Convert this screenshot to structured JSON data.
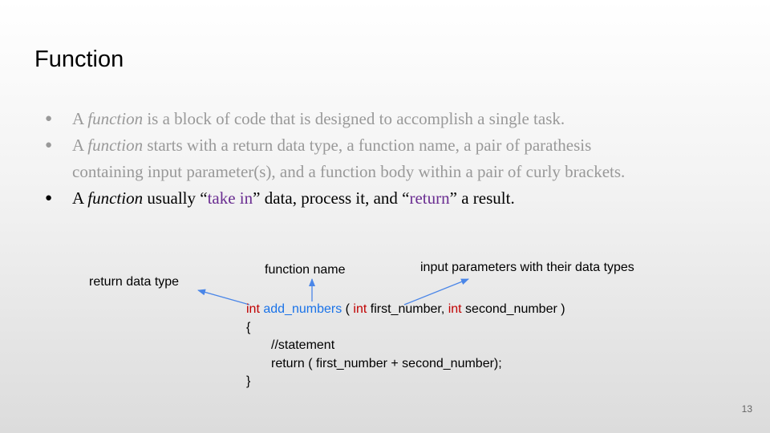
{
  "slide": {
    "title": "Function",
    "page_number": "13"
  },
  "bullets": [
    {
      "parts": [
        "A ",
        "function",
        " is a block of code that is designed to accomplish a single task."
      ]
    },
    {
      "parts": [
        "A ",
        "function",
        " starts with a return data type, a function name, a pair of parathesis"
      ],
      "continuation": "containing input parameter(s), and a function body within a pair of curly brackets."
    },
    {
      "parts": [
        "A ",
        "function",
        " usually “",
        "take in",
        "” data, process it, and “",
        "return",
        "” a result."
      ]
    }
  ],
  "labels": {
    "return_type": "return data type",
    "function_name": "function name",
    "params": "input parameters with their data types"
  },
  "code": {
    "kw1": "int",
    "fn_name": "add_numbers",
    "paren_open": " ( ",
    "kw2": "int",
    "param1": " first_number, ",
    "kw3": "int",
    "param2": " second_number )",
    "brace_open": "{",
    "comment": "//statement",
    "return_stmt": "return ( first_number + second_number);",
    "brace_close": "}"
  },
  "colors": {
    "keyword": "#c00000",
    "function_name": "#1a73e8",
    "emphasis": "#6a2d91",
    "arrow": "#4a86e8",
    "dim_text": "#999999"
  }
}
